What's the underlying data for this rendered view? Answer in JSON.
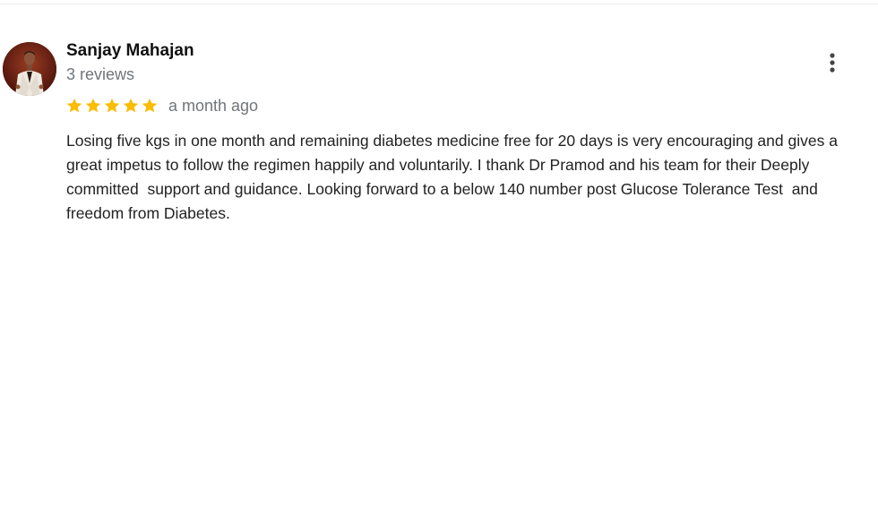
{
  "review": {
    "reviewer_name": "Sanjay Mahajan",
    "review_count": "3 reviews",
    "rating": 5,
    "rating_max": 5,
    "date": "a month ago",
    "text": "Losing five kgs in one month and remaining diabetes medicine free for 20 days is very encouraging and gives a great impetus to follow the regimen happily and voluntarily. I thank Dr Pramod and his team for their Deeply  committed  support and guidance. Looking forward to a below 140 number post Glucose Tolerance Test  and freedom from Diabetes."
  },
  "icons": {
    "star": "star-icon",
    "more": "more-vert-icon"
  },
  "colors": {
    "star": "#fbbc04",
    "name": "#111111",
    "muted": "#70757a",
    "body_text": "#222222",
    "avatar_bg": "#6e1f14"
  }
}
